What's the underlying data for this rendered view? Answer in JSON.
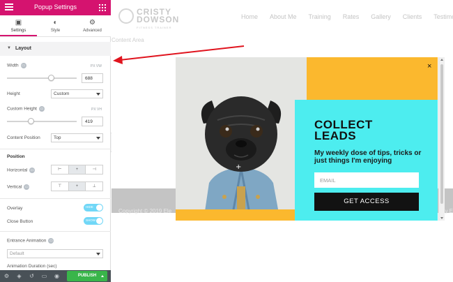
{
  "panel": {
    "header_title": "Popup Settings",
    "tabs": [
      {
        "label": "Settings",
        "icon": "settings-icon",
        "glyph": "▣"
      },
      {
        "label": "Style",
        "icon": "style-icon",
        "glyph": "◐"
      },
      {
        "label": "Advanced",
        "icon": "gear-icon",
        "glyph": "⚙"
      }
    ],
    "layout_section": "Layout",
    "width_label": "Width",
    "width_value": "688",
    "width_unit": "PX VW",
    "height_label": "Height",
    "height_value": "Custom",
    "custom_height_label": "Custom Height",
    "custom_height_value": "419",
    "custom_height_unit": "PX VH",
    "content_position_label": "Content Position",
    "content_position_value": "Top",
    "position_heading": "Position",
    "horizontal_label": "Horizontal",
    "vertical_label": "Vertical",
    "horizontal_options": [
      "⊢",
      "+",
      "⊣"
    ],
    "vertical_options": [
      "⊤",
      "+",
      "⊥"
    ],
    "overlay_label": "Overlay",
    "overlay_toggle_text": "HIDE",
    "close_button_label": "Close Button",
    "close_button_toggle_text": "SHOW",
    "entrance_animation_label": "Entrance Animation",
    "entrance_animation_value": "Default",
    "animation_duration_label": "Animation Duration (sec)",
    "publish_label": "PUBLISH"
  },
  "site": {
    "logo_line1": "CRISTY",
    "logo_line2": "DOWSON",
    "logo_sub": "FITNESS TRAINER",
    "nav": [
      "Home",
      "About Me",
      "Training",
      "Rates",
      "Gallery",
      "Clients",
      "Testimo"
    ],
    "content_area": "Content Area",
    "footer_text": "Copyright © 2019 Ele",
    "footer_right": "y E"
  },
  "popup": {
    "heading": "COLLECT LEADS",
    "tagline": "My weekly dose of tips, tricks or just things I'm enjoying",
    "email_placeholder": "EMAIL",
    "cta": "GET ACCESS",
    "close": "×"
  },
  "colors": {
    "brand_pink": "#d5136f",
    "popup_orange": "#fbb82e",
    "popup_cyan": "#4dedef",
    "publish_green": "#39b54a",
    "annotation_red": "#e0141e"
  }
}
